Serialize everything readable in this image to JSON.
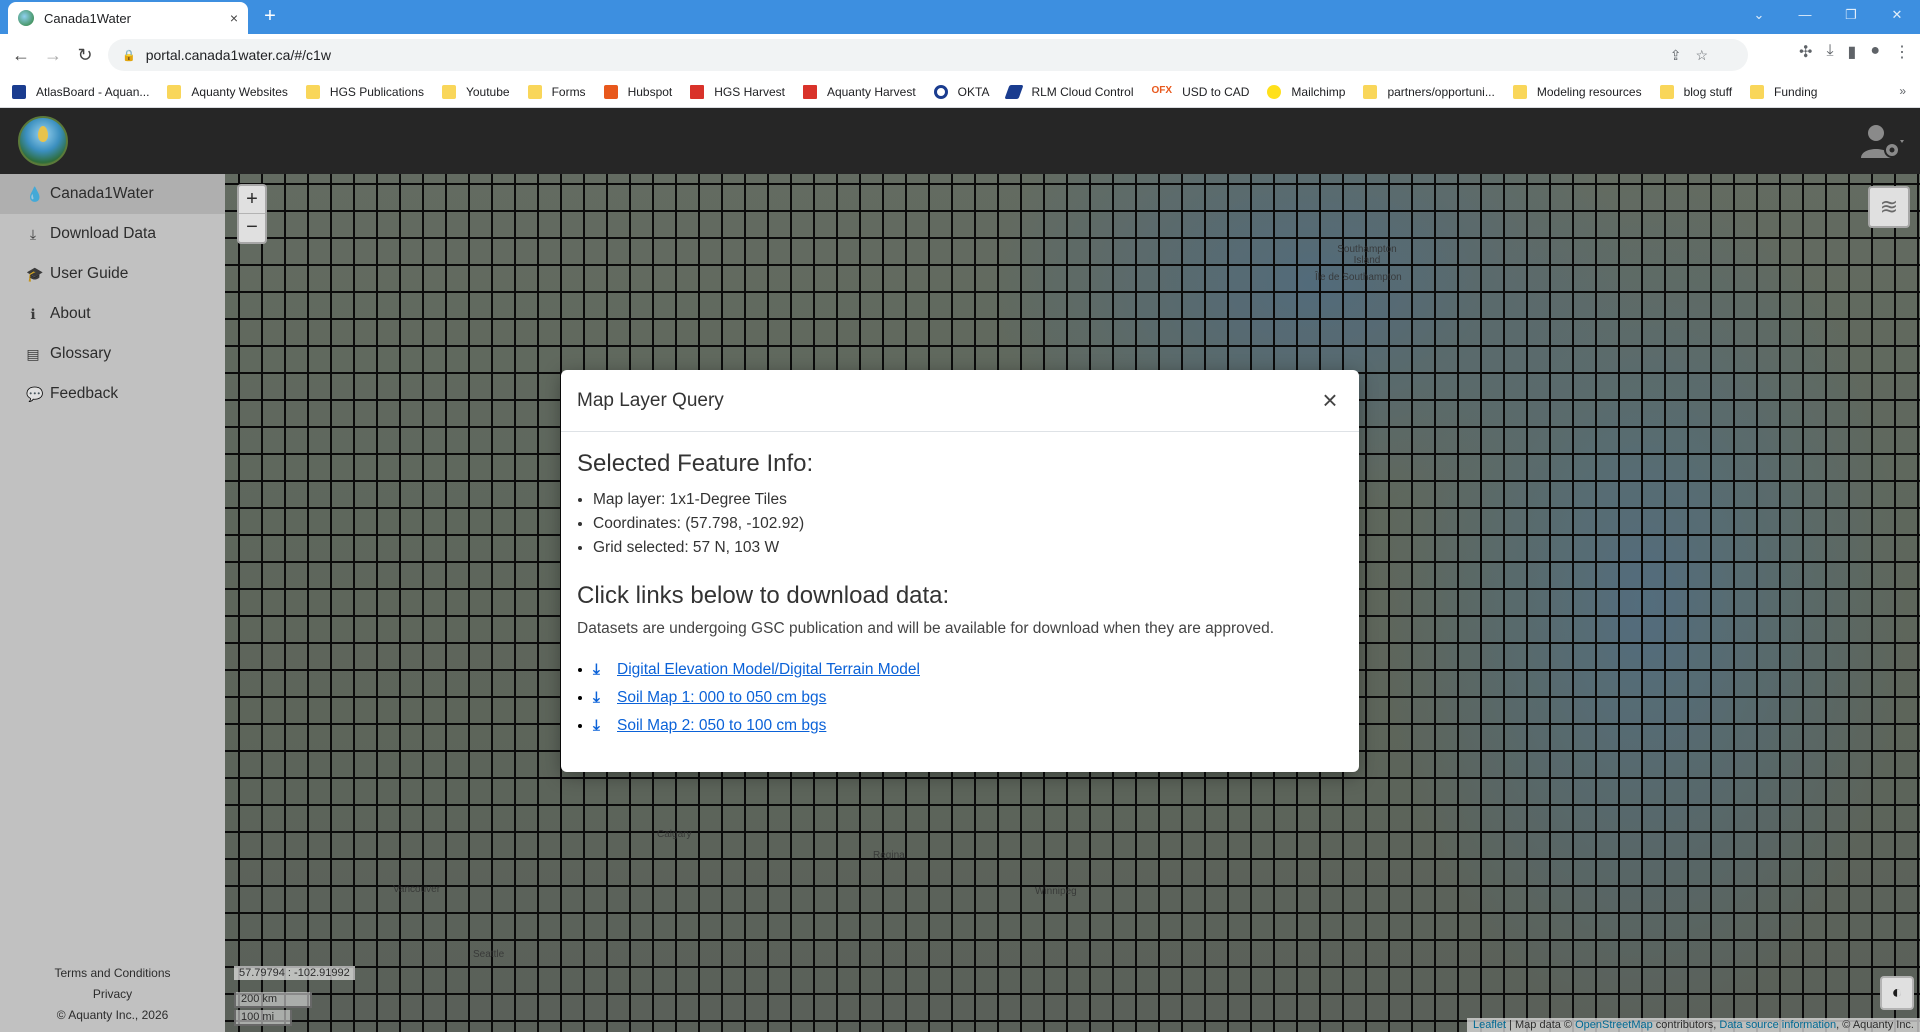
{
  "browser": {
    "tab_title": "Canada1Water",
    "tab_close": "×",
    "new_tab": "+",
    "url": "portal.canada1water.ca/#/c1w",
    "window_controls": [
      "⌄",
      "—",
      "❐",
      "✕"
    ],
    "bookmarks": [
      {
        "label": "AtlasBoard - Aquan...",
        "icon": "app"
      },
      {
        "label": "Aquanty Websites",
        "icon": "folder"
      },
      {
        "label": "HGS Publications",
        "icon": "folder"
      },
      {
        "label": "Youtube",
        "icon": "folder"
      },
      {
        "label": "Forms",
        "icon": "folder"
      },
      {
        "label": "Hubspot",
        "icon": "orange"
      },
      {
        "label": "HGS Harvest",
        "icon": "red"
      },
      {
        "label": "Aquanty Harvest",
        "icon": "red"
      },
      {
        "label": "OKTA",
        "icon": "okta"
      },
      {
        "label": "RLM Cloud Control",
        "icon": "rlm"
      },
      {
        "label": "USD to CAD",
        "icon": "ofx"
      },
      {
        "label": "Mailchimp",
        "icon": "mc"
      },
      {
        "label": "partners/opportuni...",
        "icon": "folder"
      },
      {
        "label": "Modeling resources",
        "icon": "folder"
      },
      {
        "label": "blog stuff",
        "icon": "folder"
      },
      {
        "label": "Funding",
        "icon": "folder"
      }
    ],
    "ofx_text": "OFX",
    "bookmarks_more": "»"
  },
  "app": {
    "sidebar": {
      "items": [
        {
          "label": "Canada1Water",
          "icon": "●",
          "active": true
        },
        {
          "label": "Download Data",
          "icon": "⤓"
        },
        {
          "label": "User Guide",
          "icon": "🎓"
        },
        {
          "label": "About",
          "icon": "ℹ"
        },
        {
          "label": "Glossary",
          "icon": "▤"
        },
        {
          "label": "Feedback",
          "icon": "💬"
        }
      ],
      "footer": {
        "terms": "Terms and Conditions",
        "privacy": "Privacy",
        "copyright": "© Aquanty Inc., 2026"
      }
    },
    "map": {
      "zoom_in": "+",
      "zoom_out": "−",
      "coords_readout": "57.79794 : -102.91992",
      "scale_km": "200 km",
      "scale_mi": "100 mi",
      "attribution": {
        "leaflet": "Leaflet",
        "sep1": " | Map data © ",
        "osm": "OpenStreetMap",
        "contrib": " contributors, ",
        "source": "Data source information",
        "tail": ", © Aquanty Inc."
      },
      "places": [
        "Southampton Island",
        "Île de Southampton",
        "Calgary",
        "Regina",
        "Winnipeg",
        "Vancouver",
        "Seattle"
      ]
    },
    "modal": {
      "title": "Map Layer Query",
      "close": "×",
      "feature_heading": "Selected Feature Info:",
      "info": [
        "Map layer: 1x1-Degree Tiles",
        "Coordinates: (57.798, -102.92)",
        "Grid selected: 57 N, 103 W"
      ],
      "download_heading": "Click links below to download data:",
      "note": "Datasets are undergoing GSC publication and will be available for download when they are approved.",
      "links": [
        "Digital Elevation Model/Digital Terrain Model",
        "Soil Map 1: 000 to 050 cm bgs",
        "Soil Map 2: 050 to 100 cm bgs"
      ]
    }
  }
}
